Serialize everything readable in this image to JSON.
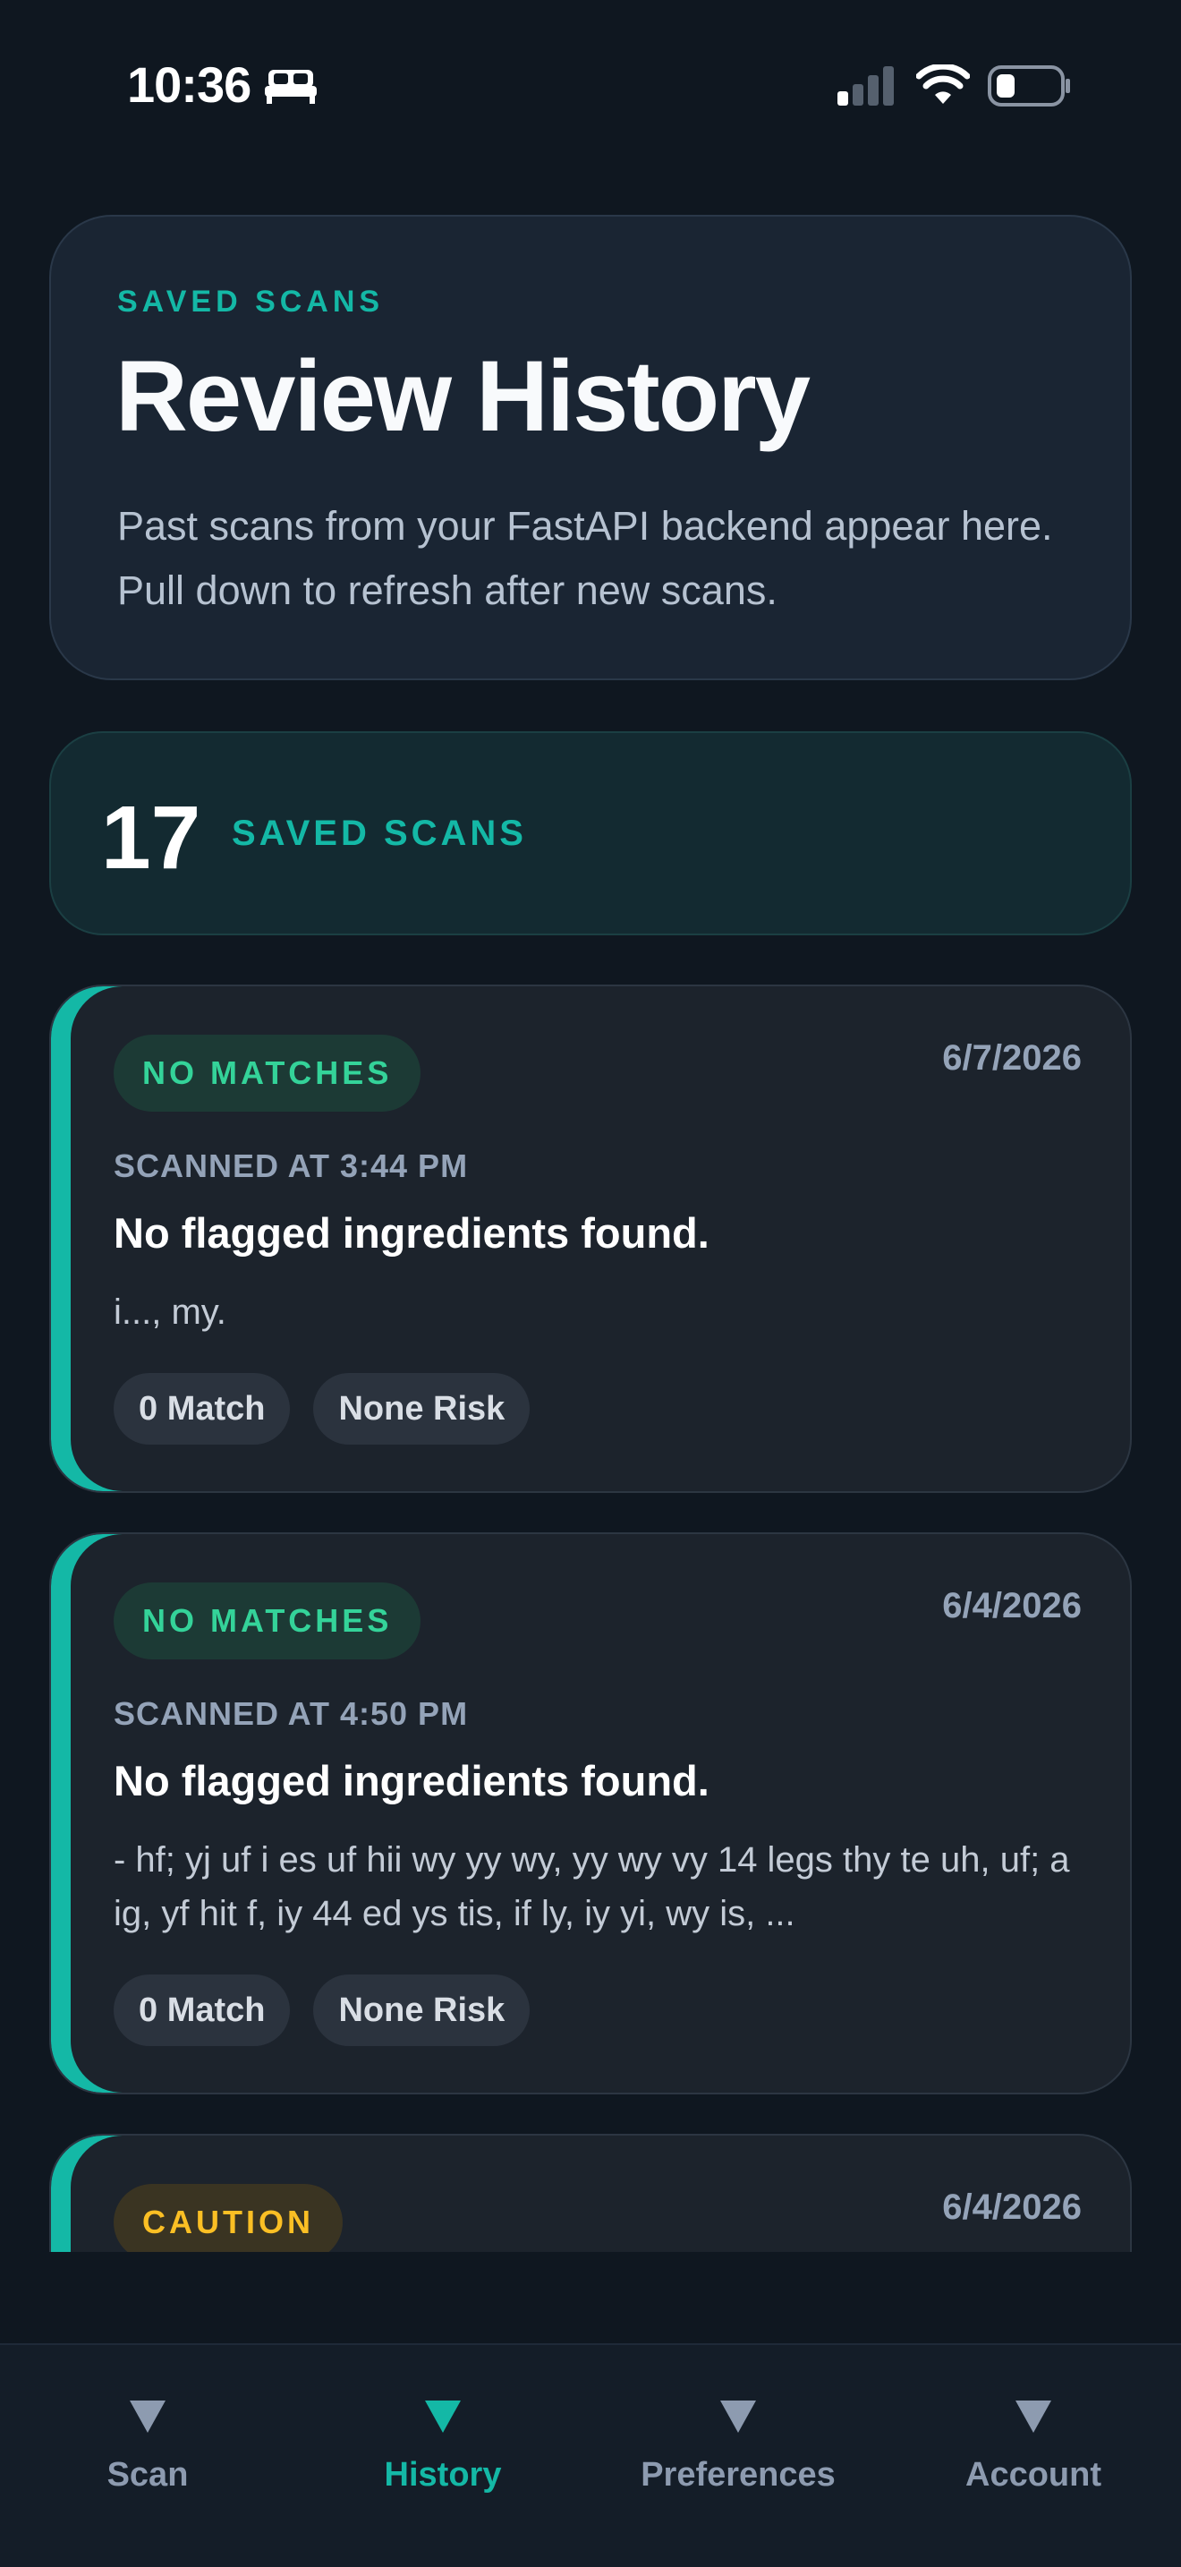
{
  "status_bar": {
    "time": "10:36",
    "icons": [
      "bed-icon",
      "signal-icon",
      "wifi-icon",
      "battery-icon"
    ]
  },
  "header": {
    "eyebrow": "SAVED SCANS",
    "title": "Review History",
    "description": "Past scans from your FastAPI backend appear here. Pull down to refresh after new scans."
  },
  "summary": {
    "count": "17",
    "label": "SAVED SCANS"
  },
  "scans": [
    {
      "status": "NO MATCHES",
      "date": "6/7/2026",
      "scanned_at": "SCANNED AT 3:44 PM",
      "headline": "No flagged ingredients found.",
      "snippet": "i..., my.",
      "match_chip": "0 Match",
      "risk_chip": "None Risk"
    },
    {
      "status": "NO MATCHES",
      "date": "6/4/2026",
      "scanned_at": "SCANNED AT 4:50 PM",
      "headline": "No flagged ingredients found.",
      "snippet": "- hf; yj uf i es uf hii wy yy wy, yy wy vy 14 legs thy te uh, uf; a ig, yf hit f, iy 44 ed ys tis, if ly, iy yi, wy is, ...",
      "match_chip": "0 Match",
      "risk_chip": "None Risk"
    },
    {
      "status": "CAUTION",
      "date": "6/4/2026"
    }
  ],
  "tabs": [
    {
      "label": "Scan",
      "active": false
    },
    {
      "label": "History",
      "active": true
    },
    {
      "label": "Preferences",
      "active": false
    },
    {
      "label": "Account",
      "active": false
    }
  ],
  "colors": {
    "background": "#0f1720",
    "accent": "#14b8a6",
    "ok": "#34d399",
    "caution": "#fbbf24"
  }
}
